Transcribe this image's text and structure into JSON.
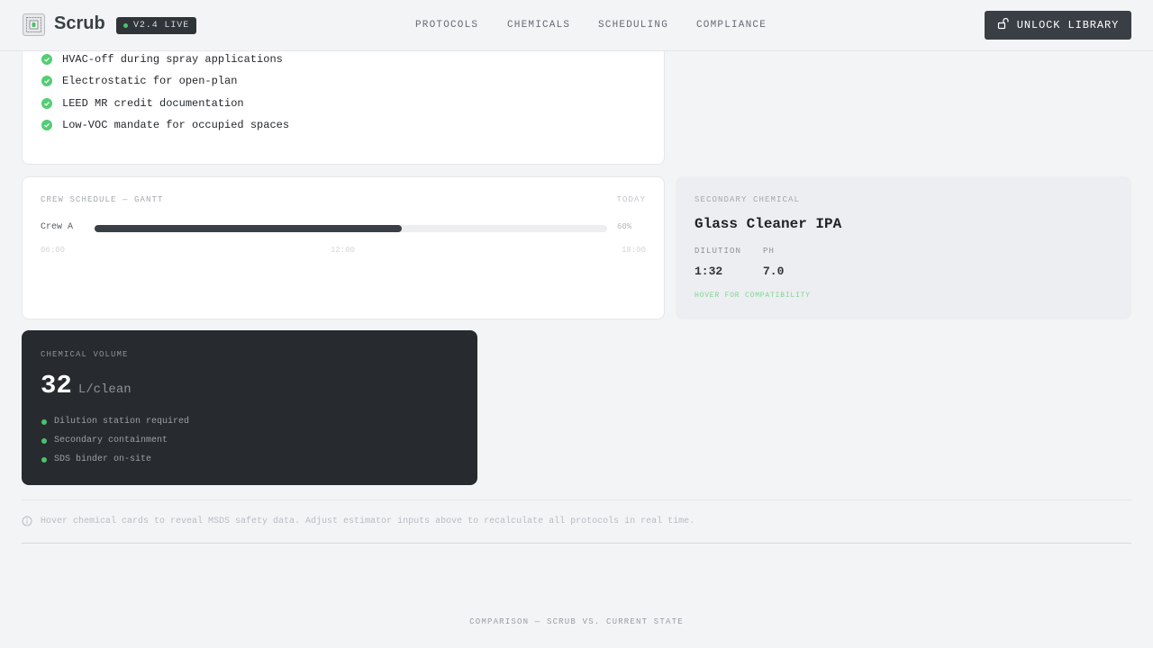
{
  "header": {
    "brand": "Scrub",
    "version_badge": "V2.4 LIVE",
    "nav": [
      "PROTOCOLS",
      "CHEMICALS",
      "SCHEDULING",
      "COMPLIANCE"
    ],
    "unlock_label": "UNLOCK LIBRARY"
  },
  "requirements": {
    "items": [
      "HVAC-off during spray applications",
      "Electrostatic for open-plan",
      "LEED MR credit documentation",
      "Low-VOC mandate for occupied spaces"
    ]
  },
  "gantt": {
    "title": "CREW SCHEDULE — GANTT",
    "today_label": "TODAY",
    "crew": "Crew A",
    "progress_label": "60%",
    "progress": 0.6,
    "times": [
      "06:00",
      "12:00",
      "18:00"
    ]
  },
  "secondary_chemical": {
    "label": "SECONDARY CHEMICAL",
    "name": "Glass Cleaner IPA",
    "dilution_label": "DILUTION",
    "dilution_value": "1:32",
    "ph_label": "PH",
    "ph_value": "7.0",
    "hint": "HOVER FOR COMPATIBILITY"
  },
  "volume": {
    "label": "CHEMICAL VOLUME",
    "value": "32",
    "unit": "L/clean",
    "items": [
      "Dilution station required",
      "Secondary containment",
      "SDS binder on-site"
    ]
  },
  "footer": {
    "note": "Hover chemical cards to reveal MSDS safety data. Adjust estimator inputs above to recalculate all protocols in real time.",
    "comparison": "COMPARISON — SCRUB VS. CURRENT STATE"
  },
  "colors": {
    "accent_green": "#54cd74",
    "dark_panel": "#272b2f",
    "button": "#3a3f45"
  }
}
